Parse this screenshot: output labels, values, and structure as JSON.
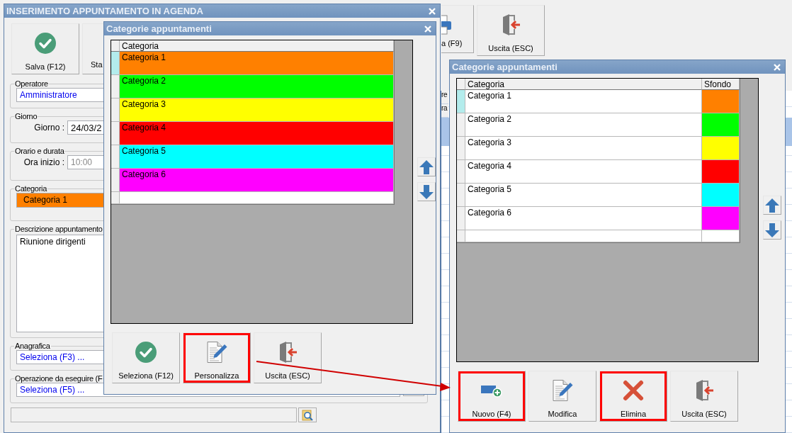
{
  "background_window": {
    "toolbar": [
      {
        "kind": "print",
        "label": "a (F9)",
        "highlighted": false
      },
      {
        "kind": "exit",
        "label": "Uscita (ESC)",
        "highlighted": false
      }
    ],
    "grid_fragments": [
      "re",
      "ra"
    ]
  },
  "main_window": {
    "title": "INSERIMENTO APPUNTAMENTO IN AGENDA",
    "toolbar": [
      {
        "kind": "save",
        "label": "Salva (F12)",
        "highlighted": false
      },
      {
        "kind": "partial",
        "label": "Sta",
        "highlighted": false
      }
    ],
    "groups": [
      {
        "kind": "lookup",
        "legend": "Operatore",
        "value": "Amministratore"
      },
      {
        "kind": "date",
        "legend": "Giorno",
        "label": "Giorno :",
        "value": "24/03/2"
      },
      {
        "kind": "time",
        "legend": "Orario e durata",
        "label": "Ora inizio :",
        "value": "10:00",
        "disabled": true
      },
      {
        "kind": "color",
        "legend": "Categoria",
        "value": "Categoria 1",
        "color": "#ff8000"
      },
      {
        "kind": "memo",
        "legend": "Descrizione appuntamento",
        "value": "Riunione dirigenti"
      },
      {
        "kind": "lookup",
        "legend": "Anagrafica",
        "value": "Seleziona (F3) ..."
      },
      {
        "kind": "lookup",
        "legend": "Operazione da eseguire (F",
        "value": "Seleziona (F5) ...",
        "browse_button": true
      }
    ]
  },
  "category_dialog": {
    "title": "Categorie appuntamenti",
    "columns": [
      "Categoria"
    ],
    "rows": [
      {
        "label": "Categoria 1",
        "color": "#ff8000",
        "selected": true
      },
      {
        "label": "Categoria 2",
        "color": "#00ff00",
        "selected": false
      },
      {
        "label": "Categoria 3",
        "color": "#ffff00",
        "selected": false
      },
      {
        "label": "Categoria 4",
        "color": "#ff0000",
        "selected": false
      },
      {
        "label": "Categoria 5",
        "color": "#00ffff",
        "selected": false
      },
      {
        "label": "Categoria 6",
        "color": "#ff00ff",
        "selected": false
      }
    ],
    "buttons": [
      {
        "kind": "select",
        "label": "Seleziona (F12)",
        "highlighted": false
      },
      {
        "kind": "customize",
        "label": "Personalizza",
        "highlighted": true
      },
      {
        "kind": "exit",
        "label": "Uscita (ESC)",
        "highlighted": false
      }
    ]
  },
  "customize_dialog": {
    "title": "Categorie appuntamenti",
    "columns": [
      "Categoria",
      "Sfondo"
    ],
    "rows": [
      {
        "label": "Categoria 1",
        "color": "#ff8000",
        "selected": true
      },
      {
        "label": "Categoria 2",
        "color": "#00ff00",
        "selected": false
      },
      {
        "label": "Categoria 3",
        "color": "#ffff00",
        "selected": false
      },
      {
        "label": "Categoria 4",
        "color": "#ff0000",
        "selected": false
      },
      {
        "label": "Categoria 5",
        "color": "#00ffff",
        "selected": false
      },
      {
        "label": "Categoria 6",
        "color": "#ff00ff",
        "selected": false
      }
    ],
    "buttons": [
      {
        "kind": "new",
        "label": "Nuovo (F4)",
        "highlighted": true
      },
      {
        "kind": "edit",
        "label": "Modifica",
        "highlighted": false
      },
      {
        "kind": "delete",
        "label": "Elimina",
        "highlighted": true
      },
      {
        "kind": "exit",
        "label": "Uscita (ESC)",
        "highlighted": false
      }
    ]
  }
}
